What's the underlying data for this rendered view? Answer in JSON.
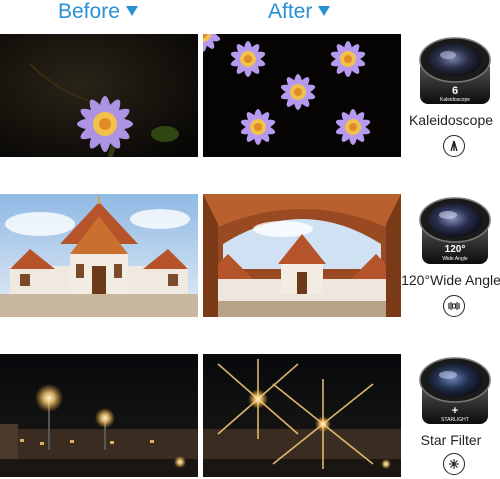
{
  "headers": {
    "before": "Before",
    "after": "After"
  },
  "rows": [
    {
      "lens_label": "Kaleidoscope",
      "lens_engraving": "6",
      "lens_sub": "Kaleidoscope",
      "badge_icon": "kaleidoscope-icon"
    },
    {
      "lens_label": "120°Wide Angle",
      "lens_engraving": "120°",
      "lens_sub": "Wide Angle",
      "badge_icon": "wide-angle-icon"
    },
    {
      "lens_label": "Star Filter",
      "lens_engraving": "+",
      "lens_sub": "STARLIGHT",
      "badge_icon": "star-filter-icon"
    }
  ],
  "colors": {
    "accent": "#2a8fd6",
    "text": "#222222"
  }
}
